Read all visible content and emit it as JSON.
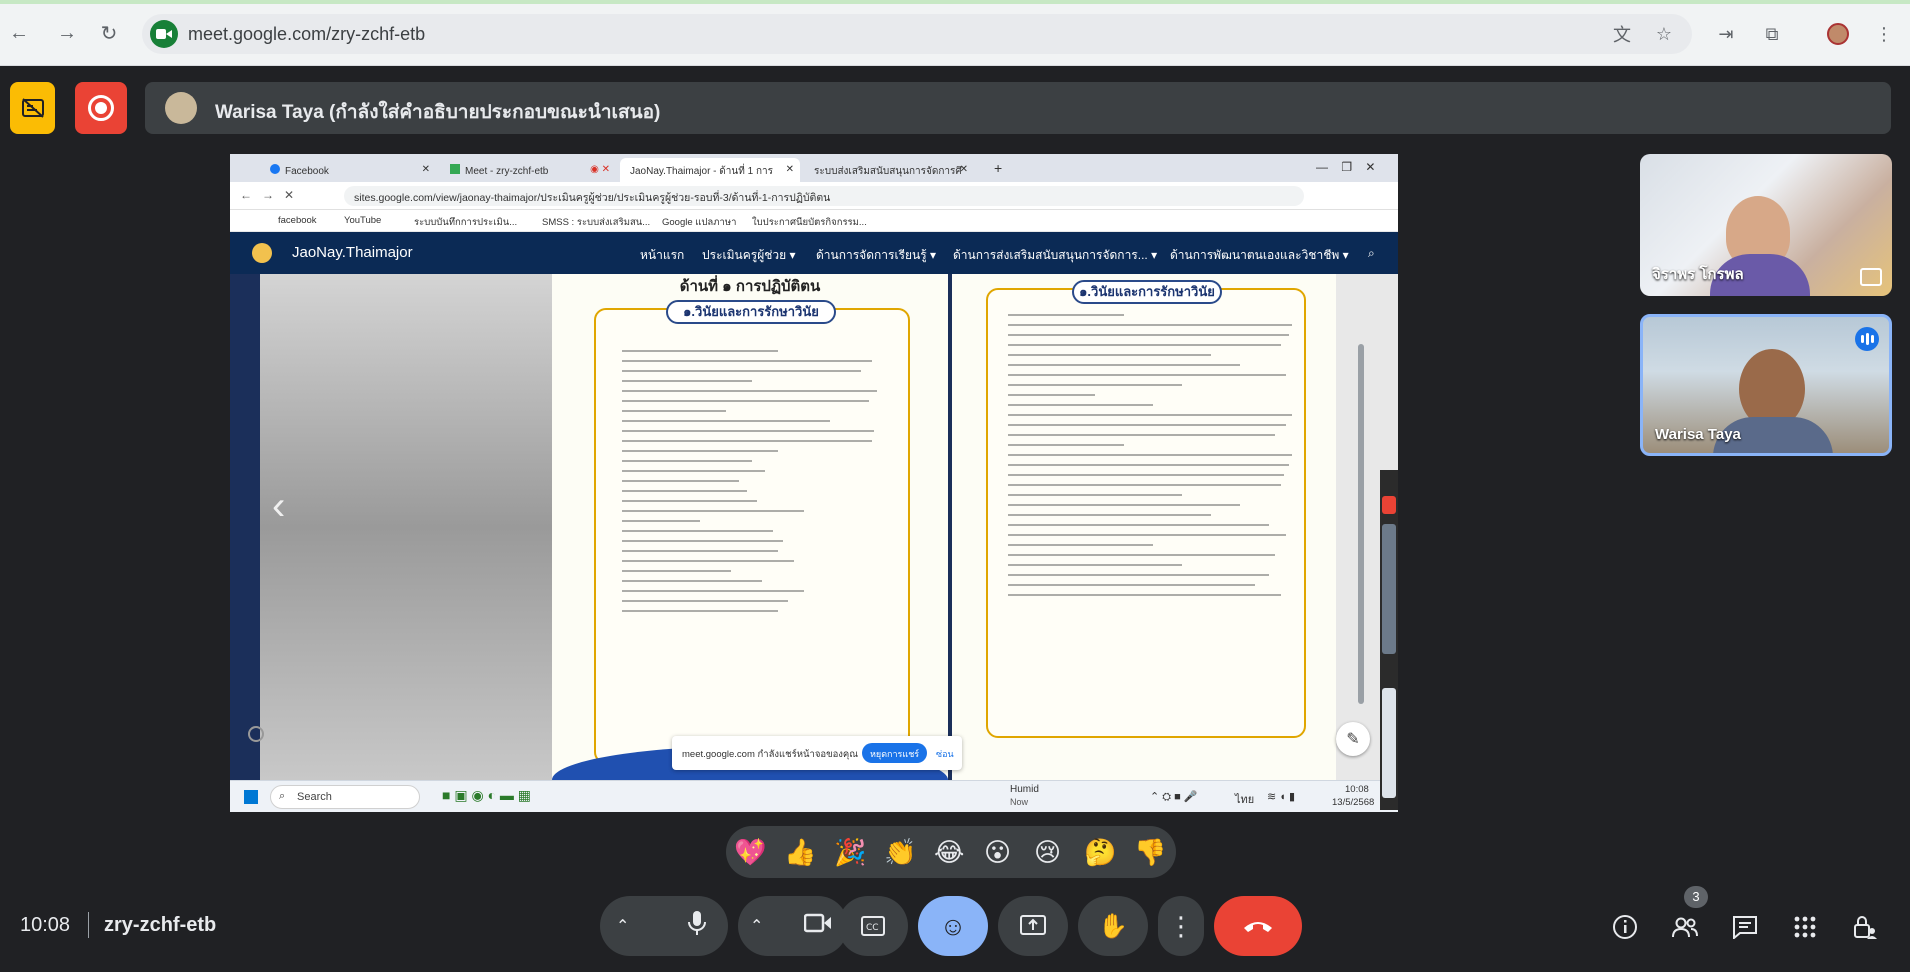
{
  "browser": {
    "url": "meet.google.com/zry-zchf-etb"
  },
  "meet": {
    "presenter_label": "Warisa Taya (กำลังใส่คำอธิบายประกอบขณะนำเสนอ)",
    "time": "10:08",
    "meeting_code": "zry-zchf-etb",
    "participants_badge": "3",
    "tiles": [
      {
        "name": "จิราพร โกรพล"
      },
      {
        "name": "Warisa Taya"
      }
    ],
    "reactions": [
      "💖",
      "👍",
      "🎉",
      "👏",
      "😂",
      "😮",
      "😢",
      "🤔",
      "👎"
    ]
  },
  "shared_screen": {
    "tabs": [
      {
        "label": "Facebook"
      },
      {
        "label": "Meet - zry-zchf-etb"
      },
      {
        "label": "JaoNay.Thaimajor - ด้านที่ 1 การ"
      },
      {
        "label": "ระบบส่งเสริมสนับสนุนการจัดการศึ"
      }
    ],
    "url": "sites.google.com/view/jaonay-thaimajor/ประเมินครูผู้ช่วย/ประเมินครูผู้ช่วย-รอบที่-3/ด้านที่-1-การปฏิบัติตน",
    "bookmarks": [
      "facebook",
      "YouTube",
      "ระบบบันทึกการประเมิน...",
      "SMSS : ระบบส่งเสริมสน...",
      "Google แปลภาษา",
      "ใบประกาศนียบัตรกิจกรรม..."
    ],
    "site_title": "JaoNay.Thaimajor",
    "site_nav": [
      "หน้าแรก",
      "ประเมินครูผู้ช่วย ▾",
      "ด้านการจัดการเรียนรู้ ▾",
      "ด้านการส่งเสริมสนับสนุนการจัดการ... ▾",
      "ด้านการพัฒนาตนเองและวิชาชีพ ▾"
    ],
    "page_left_title": "ด้านที่ ๑ การปฏิบัติตน",
    "page_left_heading": "๑.วินัยและการรักษาวินัย",
    "page_right_heading": "๑.วินัยและการรักษาวินัย",
    "notice_text": "meet.google.com กำลังแชร์หน้าจอของคุณ",
    "notice_button": "หยุดการแชร์",
    "notice_hide": "ซ่อน",
    "taskbar": {
      "search": "Search",
      "weather": "Humid",
      "weather_sub": "Now",
      "lang": "ไทย",
      "clock_time": "10:08",
      "clock_date": "13/5/2568"
    }
  }
}
